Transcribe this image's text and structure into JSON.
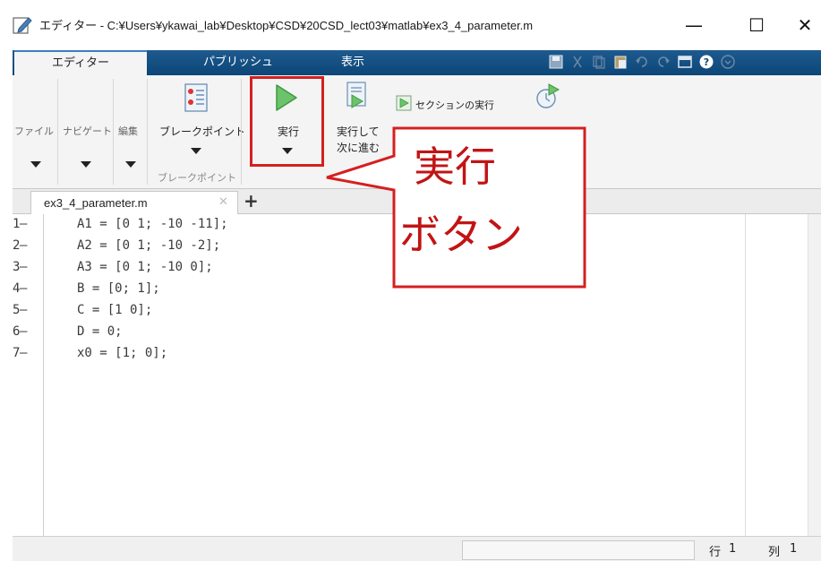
{
  "window": {
    "title": "エディター - C:¥Users¥ykawai_lab¥Desktop¥CSD¥20CSD_lect03¥matlab¥ex3_4_parameter.m",
    "minimize": "—",
    "maximize": "☐",
    "close": "✕"
  },
  "tabs": [
    "エディター",
    "パブリッシュ",
    "表示"
  ],
  "ribbon": {
    "file": "ファイル",
    "navigate": "ナビゲート",
    "edit": "編集",
    "breakpoints": "ブレークポイント",
    "breakpoints_group": "ブレークポイント",
    "run": "実行",
    "run_advance_line1": "実行して",
    "run_advance_line2": "次に進む",
    "run_section": "セクションの実行"
  },
  "document": {
    "tab_label": "ex3_4_parameter.m",
    "close_glyph": "✕",
    "add_glyph": "+"
  },
  "code_lines": [
    {
      "num": "1",
      "marker": "–",
      "text": "A1 = [0 1; -10 -11];"
    },
    {
      "num": "2",
      "marker": "–",
      "text": "A2 = [0 1; -10 -2];"
    },
    {
      "num": "3",
      "marker": "–",
      "text": "A3 = [0 1; -10 0];"
    },
    {
      "num": "4",
      "marker": "–",
      "text": "B = [0; 1];"
    },
    {
      "num": "5",
      "marker": "–",
      "text": "C = [1 0];"
    },
    {
      "num": "6",
      "marker": "–",
      "text": "D = 0;"
    },
    {
      "num": "7",
      "marker": "–",
      "text": "x0 = [1; 0];"
    }
  ],
  "status": {
    "row_label": "行",
    "row_value": "1",
    "col_label": "列",
    "col_value": "1"
  },
  "callout": {
    "line1": "実行",
    "line2": "ボタン"
  },
  "colors": {
    "tab_bar": "#0d4677",
    "highlight": "#d42020",
    "callout_text": "#c21414",
    "run_icon": "#5cb85c"
  }
}
